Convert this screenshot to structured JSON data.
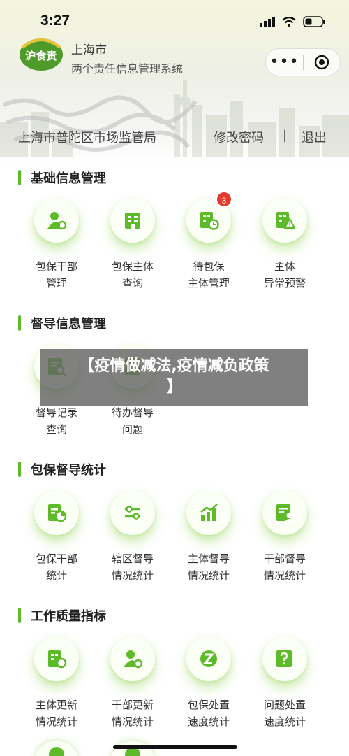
{
  "status": {
    "time": "3:27"
  },
  "header": {
    "brand_line1": "上海市",
    "brand_line2": "两个责任信息管理系统",
    "logo_text": "沪食责",
    "capsule_more": "•••",
    "unit_name": "上海市普陀区市场监管局",
    "change_password": "修改密码",
    "divider": "|",
    "logout": "退出"
  },
  "sections": [
    {
      "title": "基础信息管理",
      "items": [
        {
          "label": "包保干部\n管理",
          "icon": "person-gear-icon"
        },
        {
          "label": "包保主体\n查询",
          "icon": "building-icon"
        },
        {
          "label": "待包保\n主体管理",
          "icon": "building-clock-icon",
          "badge": "3"
        },
        {
          "label": "主体\n异常预警",
          "icon": "building-alert-icon"
        }
      ]
    },
    {
      "title": "督导信息管理",
      "items": [
        {
          "label": "督导记录\n查询",
          "icon": "record-search-icon"
        },
        {
          "label": "待办督导\n问题",
          "icon": "todo-issue-icon"
        }
      ]
    },
    {
      "title": "包保督导统计",
      "items": [
        {
          "label": "包保干部\n统计",
          "icon": "chart-stat-icon"
        },
        {
          "label": "辖区督导\n情况统计",
          "icon": "sliders-icon"
        },
        {
          "label": "主体督导\n情况统计",
          "icon": "bar-trend-icon"
        },
        {
          "label": "干部督导\n情况统计",
          "icon": "doc-person-icon"
        }
      ]
    },
    {
      "title": "工作质量指标",
      "items": [
        {
          "label": "主体更新\n情况统计",
          "icon": "building-refresh-icon"
        },
        {
          "label": "干部更新\n情况统计",
          "icon": "person-refresh-icon"
        },
        {
          "label": "包保处置\n速度统计",
          "icon": "speed-z-icon"
        },
        {
          "label": "问题处置\n速度统计",
          "icon": "question-edit-icon"
        }
      ]
    }
  ],
  "overlay": {
    "line1": "【疫情做减法,疫情减负政策",
    "line2": "】"
  },
  "colors": {
    "accent": "#5dbb2a",
    "badge": "#e43a2e",
    "icon_green": "#5dbb2a"
  }
}
